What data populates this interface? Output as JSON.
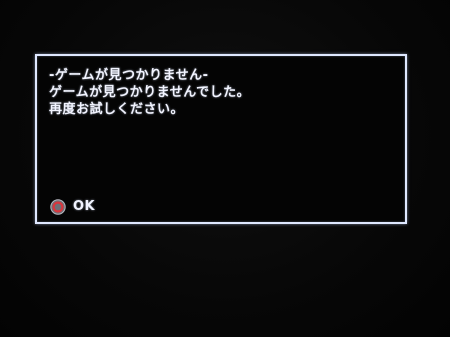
{
  "dialog": {
    "message_lines": [
      "-ゲームが見つかりません-",
      "ゲームが見つかりませんでした。",
      "再度お試しください。"
    ],
    "ok_label": "OK",
    "ok_icon": "circle-button-icon"
  },
  "colors": {
    "background": "#060606",
    "dialog_border": "#dfe8ff",
    "text": "#f2f4ff",
    "circle_button_ring": "#9a9ba3",
    "circle_button_fill": "#c8262d"
  }
}
